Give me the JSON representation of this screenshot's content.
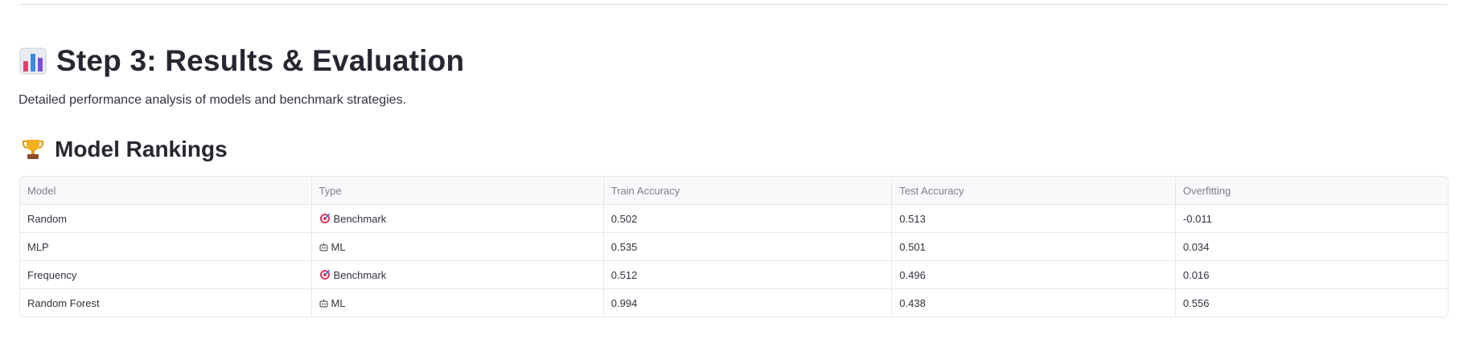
{
  "header": {
    "title": "Step 3: Results & Evaluation",
    "title_icon": "bar-chart-icon",
    "subtitle": "Detailed performance analysis of models and benchmark strategies."
  },
  "rankings": {
    "title": "Model Rankings",
    "title_icon": "trophy-icon",
    "columns": [
      "Model",
      "Type",
      "Train Accuracy",
      "Test Accuracy",
      "Overfitting"
    ],
    "rows": [
      {
        "model": "Random",
        "type": "Benchmark",
        "type_icon": "target-icon",
        "train": "0.502",
        "test": "0.513",
        "overfitting": "-0.011"
      },
      {
        "model": "MLP",
        "type": "ML",
        "type_icon": "robot-icon",
        "train": "0.535",
        "test": "0.501",
        "overfitting": "0.034"
      },
      {
        "model": "Frequency",
        "type": "Benchmark",
        "type_icon": "target-icon",
        "train": "0.512",
        "test": "0.496",
        "overfitting": "0.016"
      },
      {
        "model": "Random Forest",
        "type": "ML",
        "type_icon": "robot-icon",
        "train": "0.994",
        "test": "0.438",
        "overfitting": "0.556"
      }
    ]
  },
  "colors": {
    "heading": "#262730",
    "text": "#31333f",
    "header_text": "#7d7f8a",
    "border": "#e6e7eb",
    "header_bg": "#f8f9fb"
  }
}
